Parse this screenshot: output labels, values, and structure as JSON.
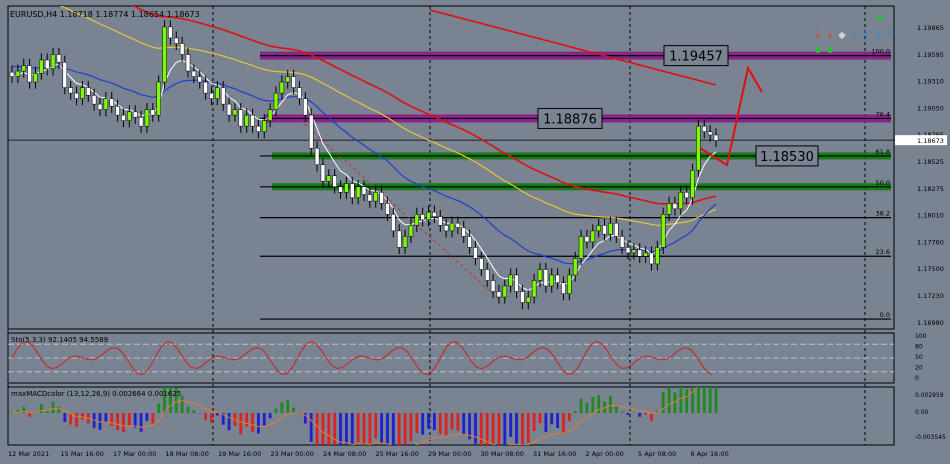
{
  "header": {
    "symbol_line": "EURUSD,H4  1.18718 1.18774 1.18654 1.18673"
  },
  "indicators": {
    "sto_label": "Sto(5,3,3) 92.1405 94.5589",
    "macd_label": "maxMACDcolor (13,12,26,9) 0.002664 0.001625"
  },
  "annotations": {
    "box_1": "1.19457",
    "box_2": "1.18876",
    "box_3": "1.18530"
  },
  "colors": {
    "background": "#798392",
    "bull": "#7CFC00",
    "bear": "#FFFFFF",
    "ma_white": "#FFFFFF",
    "ma_blue": "#1E3FD0",
    "ma_red": "#E01010",
    "ma_yellow": "#E8C832",
    "fib_line": "#000000",
    "zone_purple": "#8B1A8B",
    "zone_green": "#0B7A0B",
    "macd_green": "#1E8A1E",
    "macd_red": "#E02020",
    "macd_blue": "#2020D0"
  },
  "chart_data": {
    "type": "candlestick",
    "price_axis": {
      "ylim": [
        1.1696,
        1.1989
      ],
      "ticks": [
        "1.19865",
        "1.19595",
        "1.19310",
        "1.19050",
        "1.18795",
        "1.18525",
        "1.18275",
        "1.18010",
        "1.17760",
        "1.17500",
        "1.17230",
        "1.16980"
      ],
      "current_price": "1.18673"
    },
    "time_axis": {
      "labels": [
        "12 Mar 2021",
        "15 Mar 16:00",
        "17 Mar 00:00",
        "18 Mar 08:00",
        "19 Mar 16:00",
        "23 Mar 00:00",
        "24 Mar 08:00",
        "25 Mar 16:00",
        "29 Mar 00:00",
        "30 Mar 08:00",
        "31 Mar 16:00",
        "2 Apr 00:00",
        "5 Apr 08:00",
        "6 Apr 16:00"
      ]
    },
    "fib_levels": [
      {
        "label": "100.0",
        "price": 1.1944
      },
      {
        "label": "76.4",
        "price": 1.1887
      },
      {
        "label": "61.8",
        "price": 1.1853
      },
      {
        "label": "50.0",
        "price": 1.1825
      },
      {
        "label": "38.2",
        "price": 1.1797
      },
      {
        "label": "23.6",
        "price": 1.1762
      },
      {
        "label": "0.0",
        "price": 1.1705
      }
    ],
    "candle_closes": [
      1.1925,
      1.193,
      1.1935,
      1.192,
      1.1928,
      1.194,
      1.1932,
      1.1945,
      1.1938,
      1.1915,
      1.191,
      1.1905,
      1.1915,
      1.1908,
      1.19,
      1.1895,
      1.1905,
      1.1898,
      1.189,
      1.1885,
      1.1893,
      1.1888,
      1.188,
      1.1895,
      1.189,
      1.192,
      1.197,
      1.196,
      1.1955,
      1.1945,
      1.193,
      1.1925,
      1.192,
      1.191,
      1.1905,
      1.1915,
      1.19,
      1.189,
      1.1895,
      1.188,
      1.189,
      1.188,
      1.1875,
      1.1885,
      1.1895,
      1.191,
      1.192,
      1.1925,
      1.1915,
      1.1905,
      1.189,
      1.186,
      1.1845,
      1.183,
      1.1835,
      1.1825,
      1.182,
      1.1828,
      1.1815,
      1.1825,
      1.1818,
      1.1812,
      1.182,
      1.181,
      1.18,
      1.1785,
      1.177,
      1.178,
      1.179,
      1.18,
      1.1795,
      1.1802,
      1.1798,
      1.179,
      1.1785,
      1.1792,
      1.1788,
      1.178,
      1.177,
      1.176,
      1.175,
      1.174,
      1.173,
      1.1725,
      1.1735,
      1.1745,
      1.173,
      1.172,
      1.1725,
      1.174,
      1.175,
      1.1735,
      1.1745,
      1.1738,
      1.1728,
      1.1745,
      1.176,
      1.178,
      1.1775,
      1.1785,
      1.179,
      1.1782,
      1.1792,
      1.178,
      1.177,
      1.1765,
      1.1768,
      1.1762,
      1.1765,
      1.1755,
      1.177,
      1.18,
      1.181,
      1.1805,
      1.182,
      1.1815,
      1.184,
      1.188,
      1.1875,
      1.1872,
      1.1867
    ],
    "series": [
      {
        "name": "Sto(5,3,3) main",
        "last": 92.1405
      },
      {
        "name": "Sto(5,3,3) signal",
        "last": 94.5589
      },
      {
        "name": "maxMACDcolor main",
        "last": 0.002664
      },
      {
        "name": "maxMACDcolor signal",
        "last": 0.001625
      }
    ],
    "sto_levels": [
      "100",
      "80",
      "50",
      "20",
      "0"
    ],
    "macd_axis": [
      "0.002959",
      "0.00",
      "-0.003545"
    ]
  }
}
